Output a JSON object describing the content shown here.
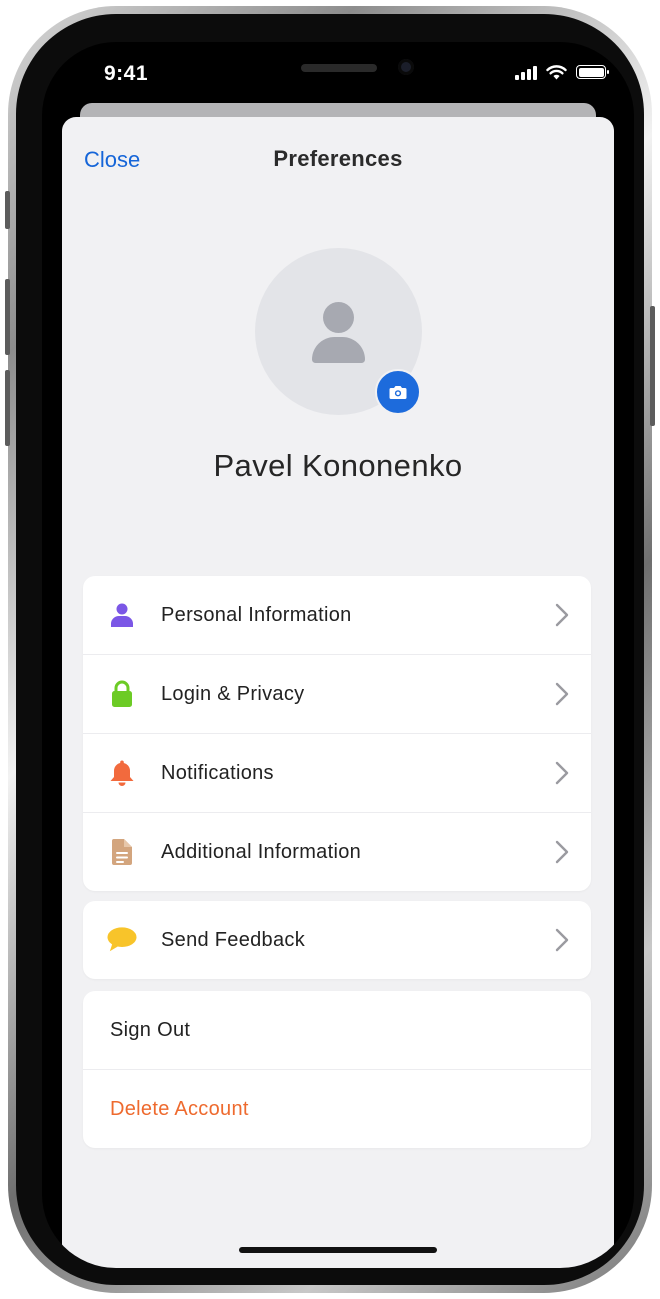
{
  "status_bar": {
    "time": "9:41"
  },
  "nav": {
    "close_label": "Close",
    "title": "Preferences"
  },
  "profile": {
    "name": "Pavel Kononenko",
    "avatar_icon": "person-icon",
    "edit_photo_icon": "camera-icon"
  },
  "menu_main": [
    {
      "label": "Personal Information",
      "icon": "person-icon",
      "icon_color": "#7b57e6"
    },
    {
      "label": "Login & Privacy",
      "icon": "lock-icon",
      "icon_color": "#6ccb25"
    },
    {
      "label": "Notifications",
      "icon": "bell-icon",
      "icon_color": "#f26a3d"
    },
    {
      "label": "Additional Information",
      "icon": "document-icon",
      "icon_color": "#d3a57e"
    }
  ],
  "menu_feedback": [
    {
      "label": "Send Feedback",
      "icon": "speech-bubble-icon",
      "icon_color": "#f8c42a"
    }
  ],
  "menu_account": [
    {
      "label": "Sign Out"
    },
    {
      "label": "Delete Account",
      "color": "#ee6a2e"
    }
  ],
  "colors": {
    "accent": "#1565d8",
    "background": "#f1f1f3",
    "card": "#ffffff",
    "danger": "#ee6a2e"
  }
}
